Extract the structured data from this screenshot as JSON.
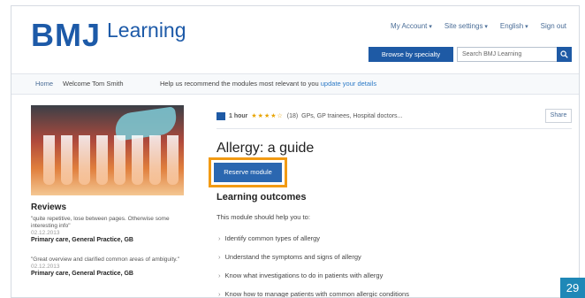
{
  "header": {
    "logo_main": "BMJ",
    "logo_sub": "Learning",
    "links": [
      "My Account",
      "Site settings",
      "English",
      "Sign out"
    ],
    "browse_button": "Browse by specialty",
    "search_placeholder": "Search BMJ Learning"
  },
  "welcome_bar": {
    "home": "Home",
    "greeting": "Welcome Tom Smith",
    "message": "Help us recommend the modules most relevant to you",
    "update_link": "update your details"
  },
  "module": {
    "format": "1 hour",
    "stars": "★★★★☆",
    "rating_count": "(18)",
    "audience": "GPs, GP trainees, Hospital doctors...",
    "share_label": "Share",
    "title": "Allergy: a guide",
    "reserve_button": "Reserve module"
  },
  "outcomes": {
    "title": "Learning outcomes",
    "intro": "This module should help you to:",
    "items": [
      "Identify common types of allergy",
      "Understand the symptoms and signs of allergy",
      "Know what investigations to do in patients with allergy",
      "Know how to manage patients with common allergic conditions"
    ]
  },
  "reviews": {
    "title": "Reviews",
    "items": [
      {
        "quote": "\"quite repetitive, lose between pages. Otherwise some interesting info\"",
        "date": "02.12.2013",
        "author": "Primary care, General Practice, GB"
      },
      {
        "quote": "\"Great overview and clarified common areas of ambiguity.\"",
        "date": "02.12.2013",
        "author": "Primary care, General Practice, GB"
      }
    ]
  },
  "page_number": "29",
  "colors": {
    "brand_blue": "#1d5aa8",
    "highlight_orange": "#f29a13",
    "page_badge": "#1f88b7"
  }
}
